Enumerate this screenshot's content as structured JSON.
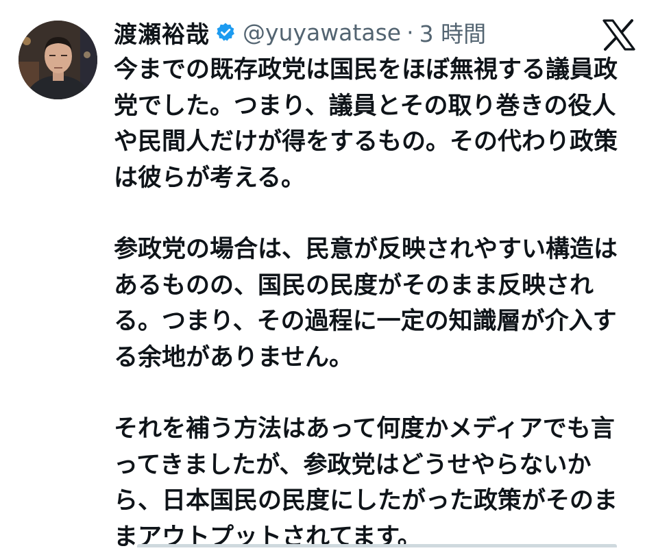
{
  "tweet": {
    "author": {
      "display_name": "渡瀬裕哉",
      "handle": "@yuyawatase",
      "verified_icon": "verified-badge-icon",
      "avatar_icon": "avatar"
    },
    "separator": "·",
    "time": "3 時間",
    "platform_icon": "x-logo-icon",
    "paragraphs": [
      {
        "lines": [
          "今までの既存政党は国民をほぼ無視する議員政",
          "党でした。つまり、議員とその取り巻きの役人",
          "や民間人だけが得をするもの。その代わり政策",
          "は彼らが考える。"
        ]
      },
      {
        "lines": [
          "参政党の場合は、民意が反映されやすい構造は",
          "あるものの、国民の民度がそのまま反映され",
          "る。つまり、その過程に一定の知識層が介入す",
          "る余地がありません。"
        ]
      },
      {
        "lines": [
          "それを補う方法はあって何度かメディアでも言",
          "ってきましたが、参政党はどうせやらないか",
          "ら、日本国民の民度にしたがった政策がそのま",
          "まアウトプットされてます。"
        ]
      }
    ]
  },
  "colors": {
    "text": "#0f1419",
    "secondary": "#536471",
    "verified": "#1d9bf0",
    "background": "#ffffff"
  }
}
